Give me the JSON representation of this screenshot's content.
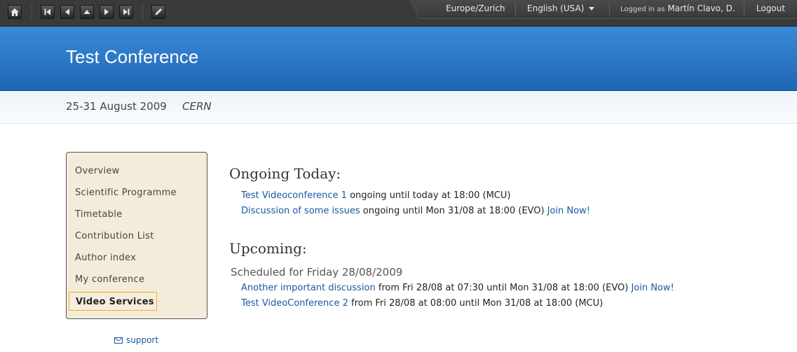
{
  "topbar": {
    "timezone": "Europe/Zurich",
    "language": "English (USA)",
    "logged_in_prefix": "Logged in as",
    "user_name": "Martín Clavo, D.",
    "logout": "Logout",
    "icons": [
      "home-icon",
      "first-icon",
      "previous-icon",
      "up-icon",
      "next-icon",
      "last-icon",
      "edit-icon"
    ]
  },
  "conference": {
    "title": "Test Conference",
    "dates": "25-31 August 2009",
    "location": "CERN"
  },
  "sidebar": {
    "items": [
      {
        "label": "Overview"
      },
      {
        "label": "Scientific Programme"
      },
      {
        "label": "Timetable"
      },
      {
        "label": "Contribution List"
      },
      {
        "label": "Author index"
      },
      {
        "label": "My conference"
      },
      {
        "label": "Video Services"
      }
    ],
    "support": "support"
  },
  "main": {
    "ongoing_heading": "Ongoing Today:",
    "ongoing": [
      {
        "title": "Test Videoconference 1",
        "detail": "ongoing until today at 18:00 (MCU)",
        "join": ""
      },
      {
        "title": "Discussion of some issues",
        "detail": "ongoing until Mon 31/08 at 18:00 (EVO)",
        "join": "Join Now!"
      }
    ],
    "upcoming_heading": "Upcoming:",
    "scheduled_label": "Scheduled for Friday 28/08/2009",
    "upcoming": [
      {
        "title": "Another important discussion",
        "detail": "from Fri 28/08 at 07:30 until Mon 31/08 at 18:00 (EVO)",
        "join": "Join Now!"
      },
      {
        "title": "Test VideoConference 2",
        "detail": "from Fri 28/08 at 08:00 until Mon 31/08 at 18:00 (MCU)",
        "join": ""
      }
    ]
  },
  "colors": {
    "banner": "#2a7acb",
    "link": "#1a58a0",
    "sidebar_bg": "#f4ecdb",
    "active_border": "#f0b020"
  }
}
